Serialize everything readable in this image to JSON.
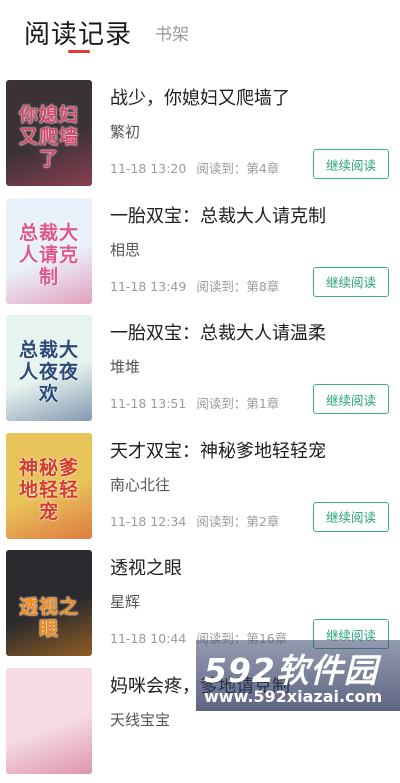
{
  "tabs": {
    "active": "阅读记录",
    "inactive": "书架"
  },
  "books": [
    {
      "title": "战少，你媳妇又爬墙了",
      "author": "繁初",
      "time": "11-18 13:20",
      "progress": "阅读到：第4章",
      "action": "继续阅读",
      "cover_text": "你媳妇又爬墙了",
      "cover_bg": "#3a3236",
      "cover_accent": "#d04a6a"
    },
    {
      "title": "一胎双宝：总裁大人请克制",
      "author": "相思",
      "time": "11-18 13:49",
      "progress": "阅读到：第8章",
      "action": "继续阅读",
      "cover_text": "总裁大人请克制",
      "cover_bg": "#e9f2fa",
      "cover_accent": "#e0578a"
    },
    {
      "title": "一胎双宝：总裁大人请温柔",
      "author": "堆堆",
      "time": "11-18 13:51",
      "progress": "阅读到：第1章",
      "action": "继续阅读",
      "cover_text": "总裁大人夜夜欢",
      "cover_bg": "#e7f3ef",
      "cover_accent": "#2b4a7a"
    },
    {
      "title": "天才双宝：神秘爹地轻轻宠",
      "author": "南心北往",
      "time": "11-18 12:34",
      "progress": "阅读到：第2章",
      "action": "继续阅读",
      "cover_text": "神秘爹地轻轻宠",
      "cover_bg": "#e8c35a",
      "cover_accent": "#d63a2a"
    },
    {
      "title": "透视之眼",
      "author": "星辉",
      "time": "11-18 10:44",
      "progress": "阅读到：第16章",
      "action": "继续阅读",
      "cover_text": "透视之眼",
      "cover_bg": "#2a2a2e",
      "cover_accent": "#f08a1a"
    },
    {
      "title": "妈咪会疼，爹地请克制",
      "author": "天线宝宝",
      "time": "",
      "progress": "",
      "action": "",
      "cover_text": "",
      "cover_bg": "#f6dbe3",
      "cover_accent": "#c8557a"
    }
  ],
  "watermark": {
    "logo": "592软件园",
    "url": "www.592xiazai.com"
  }
}
